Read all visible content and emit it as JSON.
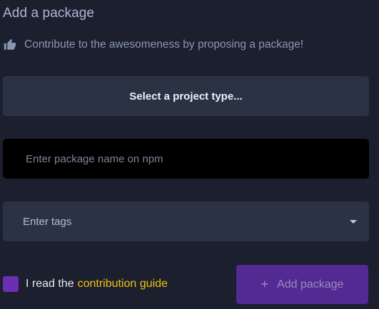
{
  "header": {
    "title": "Add a package",
    "subtitle": "Contribute to the awesomeness by proposing a package!",
    "subtitle_icon": "thumbs-up-icon"
  },
  "form": {
    "project_type_label": "Select a project type...",
    "package_name_placeholder": "Enter package name on npm",
    "package_name_value": "",
    "tags_placeholder": "Enter tags",
    "tags_dropdown_icon": "caret-down-icon"
  },
  "consent": {
    "prefix": "I read the",
    "link_text": "contribution guide",
    "checkbox_color": "#6a2fb3",
    "link_color": "#f1c40f"
  },
  "actions": {
    "add_icon": "plus-icon",
    "add_glyph": "+",
    "add_label": "Add package",
    "add_color": "#522a92"
  }
}
